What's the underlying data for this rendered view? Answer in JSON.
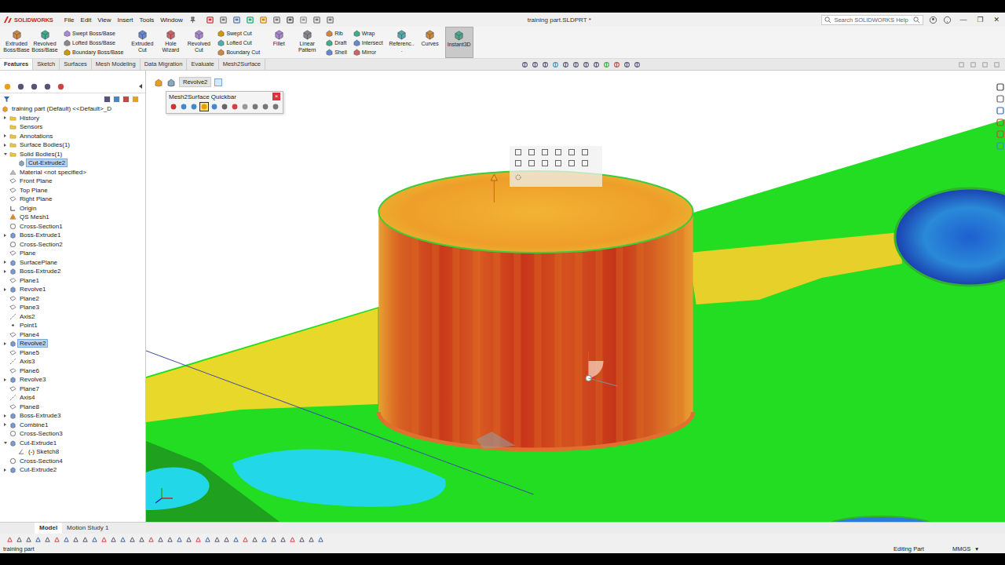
{
  "window": {
    "logo": "SOLIDWORKS",
    "title": "training part.SLDPRT *",
    "menu": [
      "File",
      "Edit",
      "View",
      "Insert",
      "Tools",
      "Window"
    ],
    "search": {
      "placeholder": "Search SOLIDWORKS Help"
    },
    "controls": [
      "—",
      "❐",
      "✕"
    ]
  },
  "ribbon": [
    {
      "kind": "large",
      "buttons": [
        {
          "label": "Extruded Boss/Base",
          "selected": false
        },
        {
          "label": "Revolved Boss/Base",
          "selected": false
        }
      ]
    },
    {
      "kind": "stack",
      "buttons": [
        {
          "label": "Swept Boss/Base",
          "selected": false
        },
        {
          "label": "Lofted Boss/Base",
          "selected": false
        },
        {
          "label": "Boundary Boss/Base",
          "selected": false
        }
      ]
    },
    {
      "kind": "large",
      "buttons": [
        {
          "label": "Extruded Cut",
          "selected": false
        },
        {
          "label": "Hole Wizard",
          "selected": false
        },
        {
          "label": "Revolved Cut",
          "selected": false
        }
      ]
    },
    {
      "kind": "stack",
      "buttons": [
        {
          "label": "Swept Cut",
          "selected": false
        },
        {
          "label": "Lofted Cut",
          "selected": false
        },
        {
          "label": "Boundary Cut",
          "selected": false
        }
      ]
    },
    {
      "kind": "large",
      "buttons": [
        {
          "label": "Fillet",
          "selected": false
        },
        {
          "label": "Linear Pattern",
          "selected": false
        }
      ]
    },
    {
      "kind": "stack",
      "buttons": [
        {
          "label": "Rib",
          "selected": false
        },
        {
          "label": "Draft",
          "selected": false
        },
        {
          "label": "Shell",
          "selected": false
        }
      ]
    },
    {
      "kind": "stack",
      "buttons": [
        {
          "label": "Wrap",
          "selected": false
        },
        {
          "label": "Intersect",
          "selected": false
        },
        {
          "label": "Mirror",
          "selected": false
        }
      ]
    },
    {
      "kind": "large",
      "buttons": [
        {
          "label": "Referenc...",
          "selected": false
        },
        {
          "label": "Curves",
          "selected": false
        },
        {
          "label": "Instant3D",
          "selected": true
        }
      ]
    }
  ],
  "tabs": [
    {
      "label": "Features",
      "selected": true
    },
    {
      "label": "Sketch",
      "selected": false
    },
    {
      "label": "Surfaces",
      "selected": false
    },
    {
      "label": "Mesh Modeling",
      "selected": false
    },
    {
      "label": "Data Migration",
      "selected": false
    },
    {
      "label": "Evaluate",
      "selected": false
    },
    {
      "label": "Mesh2Surface",
      "selected": false
    }
  ],
  "tree": {
    "items": [
      {
        "label": "training part (Default) <<Default>_D",
        "kind": "part",
        "level": 0,
        "has_children": false,
        "expanded": false,
        "selected": false
      },
      {
        "label": "History",
        "kind": "folder",
        "level": 1,
        "has_children": true,
        "expanded": false,
        "selected": false
      },
      {
        "label": "Sensors",
        "kind": "folder",
        "level": 1,
        "has_children": false,
        "expanded": false,
        "selected": false
      },
      {
        "label": "Annotations",
        "kind": "folder",
        "level": 1,
        "has_children": true,
        "expanded": false,
        "selected": false
      },
      {
        "label": "Surface Bodies(1)",
        "kind": "folder",
        "level": 1,
        "has_children": true,
        "expanded": false,
        "selected": false
      },
      {
        "label": "Solid Bodies(1)",
        "kind": "folder",
        "level": 1,
        "has_children": true,
        "expanded": true,
        "selected": false
      },
      {
        "label": "Cut-Extrude2",
        "kind": "body",
        "level": 2,
        "has_children": false,
        "expanded": false,
        "selected": true
      },
      {
        "label": "Material <not specified>",
        "kind": "material",
        "level": 1,
        "has_children": false,
        "expanded": false,
        "selected": false
      },
      {
        "label": "Front Plane",
        "kind": "plane",
        "level": 1,
        "has_children": false,
        "expanded": false,
        "selected": false
      },
      {
        "label": "Top Plane",
        "kind": "plane",
        "level": 1,
        "has_children": false,
        "expanded": false,
        "selected": false
      },
      {
        "label": "Right Plane",
        "kind": "plane",
        "level": 1,
        "has_children": false,
        "expanded": false,
        "selected": false
      },
      {
        "label": "Origin",
        "kind": "origin",
        "level": 1,
        "has_children": false,
        "expanded": false,
        "selected": false
      },
      {
        "label": "QS Mesh1",
        "kind": "mesh",
        "level": 1,
        "has_children": false,
        "expanded": false,
        "selected": false
      },
      {
        "label": "Cross-Section1",
        "kind": "section",
        "level": 1,
        "has_children": false,
        "expanded": false,
        "selected": false
      },
      {
        "label": "Boss-Extrude1",
        "kind": "feature",
        "level": 1,
        "has_children": true,
        "expanded": false,
        "selected": false
      },
      {
        "label": "Cross-Section2",
        "kind": "section",
        "level": 1,
        "has_children": false,
        "expanded": false,
        "selected": false
      },
      {
        "label": "Plane",
        "kind": "plane",
        "level": 1,
        "has_children": false,
        "expanded": false,
        "selected": false
      },
      {
        "label": "SurfacePlane",
        "kind": "feature",
        "level": 1,
        "has_children": true,
        "expanded": false,
        "selected": false
      },
      {
        "label": "Boss-Extrude2",
        "kind": "feature",
        "level": 1,
        "has_children": true,
        "expanded": false,
        "selected": false
      },
      {
        "label": "Plane1",
        "kind": "plane",
        "level": 1,
        "has_children": false,
        "expanded": false,
        "selected": false
      },
      {
        "label": "Revolve1",
        "kind": "feature",
        "level": 1,
        "has_children": true,
        "expanded": false,
        "selected": false
      },
      {
        "label": "Plane2",
        "kind": "plane",
        "level": 1,
        "has_children": false,
        "expanded": false,
        "selected": false
      },
      {
        "label": "Plane3",
        "kind": "plane",
        "level": 1,
        "has_children": false,
        "expanded": false,
        "selected": false
      },
      {
        "label": "Axis2",
        "kind": "axis",
        "level": 1,
        "has_children": false,
        "expanded": false,
        "selected": false
      },
      {
        "label": "Point1",
        "kind": "point",
        "level": 1,
        "has_children": false,
        "expanded": false,
        "selected": false
      },
      {
        "label": "Plane4",
        "kind": "plane",
        "level": 1,
        "has_children": false,
        "expanded": false,
        "selected": false
      },
      {
        "label": "Revolve2",
        "kind": "feature",
        "level": 1,
        "has_children": true,
        "expanded": false,
        "selected": true
      },
      {
        "label": "Plane5",
        "kind": "plane",
        "level": 1,
        "has_children": false,
        "expanded": false,
        "selected": false
      },
      {
        "label": "Axis3",
        "kind": "axis",
        "level": 1,
        "has_children": false,
        "expanded": false,
        "selected": false
      },
      {
        "label": "Plane6",
        "kind": "plane",
        "level": 1,
        "has_children": false,
        "expanded": false,
        "selected": false
      },
      {
        "label": "Revolve3",
        "kind": "feature",
        "level": 1,
        "has_children": true,
        "expanded": false,
        "selected": false
      },
      {
        "label": "Plane7",
        "kind": "plane",
        "level": 1,
        "has_children": false,
        "expanded": false,
        "selected": false
      },
      {
        "label": "Axis4",
        "kind": "axis",
        "level": 1,
        "has_children": false,
        "expanded": false,
        "selected": false
      },
      {
        "label": "Plane8",
        "kind": "plane",
        "level": 1,
        "has_children": false,
        "expanded": false,
        "selected": false
      },
      {
        "label": "Boss-Extrude3",
        "kind": "feature",
        "level": 1,
        "has_children": true,
        "expanded": false,
        "selected": false
      },
      {
        "label": "Combine1",
        "kind": "feature",
        "level": 1,
        "has_children": true,
        "expanded": false,
        "selected": false
      },
      {
        "label": "Cross-Section3",
        "kind": "section",
        "level": 1,
        "has_children": false,
        "expanded": false,
        "selected": false
      },
      {
        "label": "Cut-Extrude1",
        "kind": "feature",
        "level": 1,
        "has_children": true,
        "expanded": true,
        "selected": false
      },
      {
        "label": "(-) Sketch8",
        "kind": "sketch",
        "level": 2,
        "has_children": false,
        "expanded": false,
        "selected": false
      },
      {
        "label": "Cross-Section4",
        "kind": "section",
        "level": 1,
        "has_children": false,
        "expanded": false,
        "selected": false
      },
      {
        "label": "Cut-Extrude2",
        "kind": "feature",
        "level": 1,
        "has_children": true,
        "expanded": false,
        "selected": false
      }
    ]
  },
  "breadcrumb": {
    "label": "Revolve2"
  },
  "quickbar": {
    "title": "Mesh2Surface Quickbar",
    "close": "×"
  },
  "bottom_tabs": [
    {
      "label": "Model",
      "selected": true
    },
    {
      "label": "Motion Study 1",
      "selected": false
    }
  ],
  "status_bar": {
    "left": "training part",
    "mode": "Editing Part",
    "units": "MMGS",
    "dropdown": "▾"
  }
}
